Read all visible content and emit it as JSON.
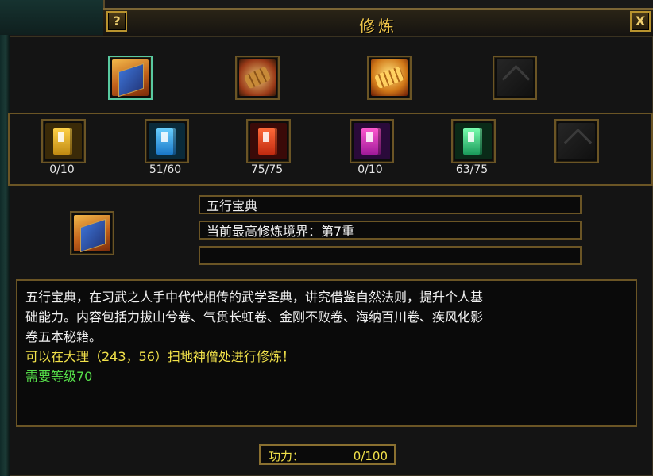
{
  "window": {
    "title": "修炼",
    "help_label": "?",
    "close_label": "X"
  },
  "top_row": [
    {
      "icon": "wuxing-baodian-book-icon",
      "selected": true
    },
    {
      "icon": "bamboo-scroll-bundle-icon",
      "selected": false
    },
    {
      "icon": "golden-scroll-bundle-icon",
      "selected": false
    },
    {
      "icon": "empty-slot-icon",
      "selected": false
    }
  ],
  "manuals": [
    {
      "icon": "yellow-manual-icon",
      "count": "0/10"
    },
    {
      "icon": "blue-manual-icon",
      "count": "51/60"
    },
    {
      "icon": "red-manual-icon",
      "count": "75/75"
    },
    {
      "icon": "purple-manual-icon",
      "count": "0/10"
    },
    {
      "icon": "green-manual-icon",
      "count": "63/75"
    },
    {
      "icon": "empty-slot-icon",
      "count": ""
    }
  ],
  "detail": {
    "icon": "wuxing-baodian-book-icon",
    "name": "五行宝典",
    "realm": "当前最高修炼境界：第7重",
    "extra": ""
  },
  "description": {
    "line1": "五行宝典，在习武之人手中代代相传的武学圣典，讲究借鉴自然法则，提升个人基",
    "line2": "础能力。内容包括力拔山兮卷、气贯长虹卷、金刚不败卷、海纳百川卷、疾风化影",
    "line3": "卷五本秘籍。",
    "location": "可以在大理（243，56）扫地神僧处进行修炼！",
    "requirement": "需要等级70"
  },
  "power": {
    "label": "功力：",
    "value": "0/100"
  },
  "colors": {
    "title": "#f0c64a",
    "frame": "#6b5525",
    "selected": "#59c9a0",
    "yellow_text": "#f2e24a",
    "green_text": "#56e04a"
  }
}
